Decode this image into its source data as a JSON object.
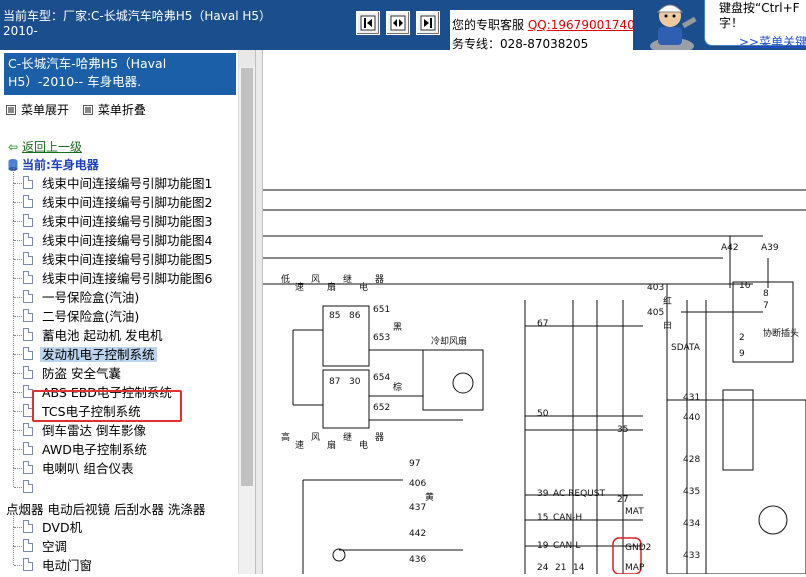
{
  "header": {
    "title_line1": "当前车型：厂家:C-长城汽车哈弗H5（Haval H5）",
    "title_line2": "2010-",
    "contact_prefix": "您的专职客服",
    "qq": "QQ:19679001740",
    "phone_line": "务专线：028-87038205",
    "tip_line1": "键盘按“Ctrl+F",
    "tip_line2": "字！",
    "tip_link": ">>菜单关键"
  },
  "nav_icons": [
    "first-page-icon",
    "split-view-icon",
    "last-page-icon"
  ],
  "sidebar": {
    "selected_title": "C-长城汽车-哈弗H5（Haval H5）-2010-- 车身电器.",
    "expand_label": "菜单展开",
    "collapse_label": "菜单折叠",
    "back_label": "返回上一级",
    "current_label": "当前:车身电器",
    "items": [
      {
        "label": "线束中间连接编号引脚功能图1"
      },
      {
        "label": "线束中间连接编号引脚功能图2"
      },
      {
        "label": "线束中间连接编号引脚功能图3"
      },
      {
        "label": "线束中间连接编号引脚功能图4"
      },
      {
        "label": "线束中间连接编号引脚功能图5"
      },
      {
        "label": "线束中间连接编号引脚功能图6"
      },
      {
        "label": "一号保险盒(汽油)"
      },
      {
        "label": "二号保险盒(汽油)"
      },
      {
        "label": "蓄电池 起动机 发电机"
      },
      {
        "label": "发动机电子控制系统"
      },
      {
        "label": "防盗 安全气囊"
      },
      {
        "label": "ABS EBD电子控制系统"
      },
      {
        "label": "TCS电子控制系统"
      },
      {
        "label": "倒车雷达 倒车影像"
      },
      {
        "label": "AWD电子控制系统"
      },
      {
        "label": "电喇叭 组合仪表"
      },
      {
        "label": ""
      }
    ],
    "group_label": "点烟器 电动后视镜 后刮水器 洗涤器",
    "items2": [
      {
        "label": "DVD机"
      },
      {
        "label": "空调"
      },
      {
        "label": "电动门窗"
      }
    ]
  },
  "diagram": {
    "top_labels": [
      "低",
      "速",
      "风",
      "扇",
      "继",
      "电",
      "器"
    ],
    "left_labels": [
      "高",
      "速",
      "风",
      "扇",
      "继",
      "电",
      "器"
    ],
    "wire_codes": [
      "A42",
      "A39",
      "403",
      "405",
      "651",
      "653",
      "654",
      "652",
      "440",
      "431",
      "428",
      "435",
      "434",
      "433",
      "97",
      "406",
      "437",
      "442",
      "436"
    ],
    "pin_numbers": [
      "85",
      "86",
      "87",
      "30",
      "67",
      "50",
      "35",
      "39",
      "15",
      "19",
      "27",
      "16",
      "8",
      "7",
      "9",
      "2",
      "24",
      "21",
      "14"
    ],
    "signal_labels": [
      "SDATA",
      "AC REQUST",
      "CAN-H",
      "CAN-L",
      "MAT",
      "GND2",
      "MAP"
    ],
    "misc_labels": [
      "冷却风扇",
      "协断插头",
      "红",
      "白",
      "黑",
      "棕",
      "黄"
    ]
  }
}
